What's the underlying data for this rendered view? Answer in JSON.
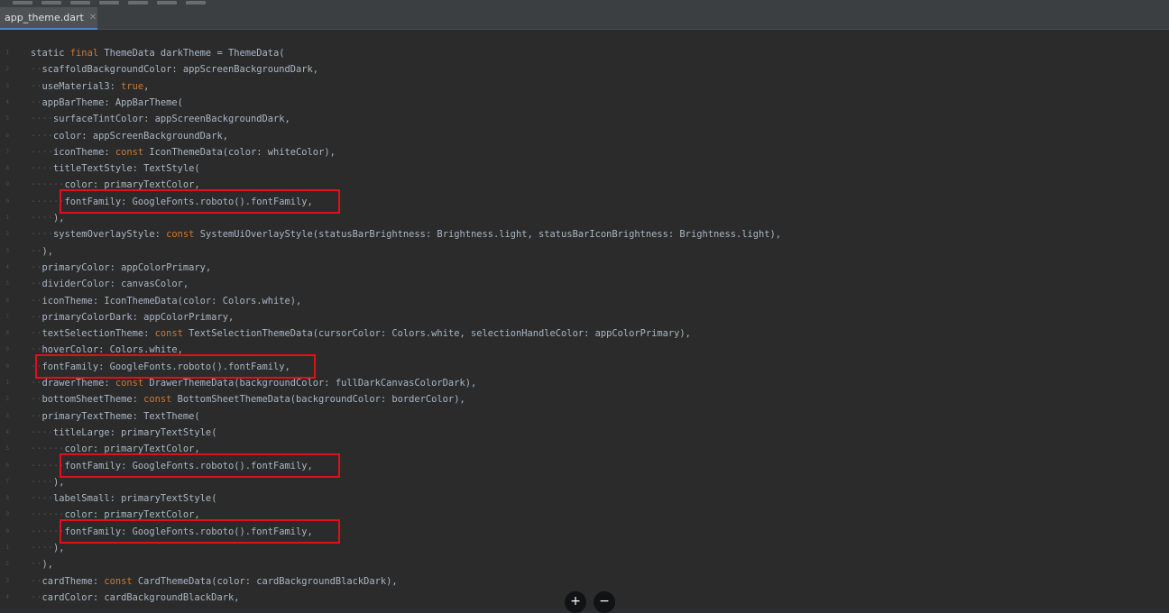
{
  "tab": {
    "title": "app_theme.dart",
    "close_icon": "close-icon"
  },
  "code_lines": [
    {
      "indent": 0,
      "segments": [
        {
          "t": "static ",
          "k": "p"
        },
        {
          "t": "final",
          "k": "kw"
        },
        {
          "t": " ThemeData darkTheme = ThemeData(",
          "k": "p"
        }
      ]
    },
    {
      "indent": 1,
      "segments": [
        {
          "t": "scaffoldBackgroundColor: appScreenBackgroundDark,",
          "k": "p"
        }
      ]
    },
    {
      "indent": 1,
      "segments": [
        {
          "t": "useMaterial3: ",
          "k": "p"
        },
        {
          "t": "true",
          "k": "kw"
        },
        {
          "t": ",",
          "k": "p"
        }
      ]
    },
    {
      "indent": 1,
      "segments": [
        {
          "t": "appBarTheme: AppBarTheme(",
          "k": "p"
        }
      ]
    },
    {
      "indent": 2,
      "segments": [
        {
          "t": "surfaceTintColor: appScreenBackgroundDark,",
          "k": "p"
        }
      ]
    },
    {
      "indent": 2,
      "segments": [
        {
          "t": "color: appScreenBackgroundDark,",
          "k": "p"
        }
      ]
    },
    {
      "indent": 2,
      "segments": [
        {
          "t": "iconTheme: ",
          "k": "p"
        },
        {
          "t": "const",
          "k": "kw"
        },
        {
          "t": " IconThemeData(color: whiteColor),",
          "k": "p"
        }
      ]
    },
    {
      "indent": 2,
      "segments": [
        {
          "t": "titleTextStyle: TextStyle(",
          "k": "p"
        }
      ]
    },
    {
      "indent": 3,
      "segments": [
        {
          "t": "color: primaryTextColor,",
          "k": "p"
        }
      ]
    },
    {
      "indent": 3,
      "segments": [
        {
          "t": "fontFamily: GoogleFonts.roboto().fontFamily,",
          "k": "p"
        }
      ]
    },
    {
      "indent": 2,
      "segments": [
        {
          "t": "),",
          "k": "p"
        }
      ]
    },
    {
      "indent": 2,
      "segments": [
        {
          "t": "systemOverlayStyle: ",
          "k": "p"
        },
        {
          "t": "const",
          "k": "kw"
        },
        {
          "t": " SystemUiOverlayStyle(statusBarBrightness: Brightness.light, statusBarIconBrightness: Brightness.light),",
          "k": "p"
        }
      ]
    },
    {
      "indent": 1,
      "segments": [
        {
          "t": "),",
          "k": "p"
        }
      ]
    },
    {
      "indent": 1,
      "segments": [
        {
          "t": "primaryColor: appColorPrimary,",
          "k": "p"
        }
      ]
    },
    {
      "indent": 1,
      "segments": [
        {
          "t": "dividerColor: canvasColor,",
          "k": "p"
        }
      ]
    },
    {
      "indent": 1,
      "segments": [
        {
          "t": "iconTheme: IconThemeData(color: Colors.white),",
          "k": "p"
        }
      ]
    },
    {
      "indent": 1,
      "segments": [
        {
          "t": "primaryColorDark: appColorPrimary,",
          "k": "p"
        }
      ]
    },
    {
      "indent": 1,
      "segments": [
        {
          "t": "textSelectionTheme: ",
          "k": "p"
        },
        {
          "t": "const",
          "k": "kw"
        },
        {
          "t": " TextSelectionThemeData(cursorColor: Colors.white, selectionHandleColor: appColorPrimary),",
          "k": "p"
        }
      ]
    },
    {
      "indent": 1,
      "segments": [
        {
          "t": "hoverColor: Colors.white,",
          "k": "p"
        }
      ]
    },
    {
      "indent": 1,
      "segments": [
        {
          "t": "fontFamily: GoogleFonts.roboto().fontFamily,",
          "k": "p"
        }
      ]
    },
    {
      "indent": 1,
      "segments": [
        {
          "t": "drawerTheme: ",
          "k": "p"
        },
        {
          "t": "const",
          "k": "kw"
        },
        {
          "t": " DrawerThemeData(backgroundColor: fullDarkCanvasColorDark),",
          "k": "p"
        }
      ]
    },
    {
      "indent": 1,
      "segments": [
        {
          "t": "bottomSheetTheme: ",
          "k": "p"
        },
        {
          "t": "const",
          "k": "kw"
        },
        {
          "t": " BottomSheetThemeData(backgroundColor: borderColor),",
          "k": "p"
        }
      ]
    },
    {
      "indent": 1,
      "segments": [
        {
          "t": "primaryTextTheme: TextTheme(",
          "k": "p"
        }
      ]
    },
    {
      "indent": 2,
      "segments": [
        {
          "t": "titleLarge: primaryTextStyle(",
          "k": "p"
        }
      ]
    },
    {
      "indent": 3,
      "segments": [
        {
          "t": "color: primaryTextColor,",
          "k": "p"
        }
      ]
    },
    {
      "indent": 3,
      "segments": [
        {
          "t": "fontFamily: GoogleFonts.roboto().fontFamily,",
          "k": "p"
        }
      ]
    },
    {
      "indent": 2,
      "segments": [
        {
          "t": "),",
          "k": "p"
        }
      ]
    },
    {
      "indent": 2,
      "segments": [
        {
          "t": "labelSmall: primaryTextStyle(",
          "k": "p"
        }
      ]
    },
    {
      "indent": 3,
      "segments": [
        {
          "t": "color: primaryTextColor,",
          "k": "p"
        }
      ]
    },
    {
      "indent": 3,
      "segments": [
        {
          "t": "fontFamily: GoogleFonts.roboto().fontFamily,",
          "k": "p"
        }
      ]
    },
    {
      "indent": 2,
      "segments": [
        {
          "t": "),",
          "k": "p"
        }
      ]
    },
    {
      "indent": 1,
      "segments": [
        {
          "t": "),",
          "k": "p"
        }
      ]
    },
    {
      "indent": 1,
      "segments": [
        {
          "t": "cardTheme: ",
          "k": "p"
        },
        {
          "t": "const",
          "k": "kw"
        },
        {
          "t": " CardThemeData(color: cardBackgroundBlackDark),",
          "k": "p"
        }
      ]
    },
    {
      "indent": 1,
      "segments": [
        {
          "t": "cardColor: cardBackgroundBlackDark,",
          "k": "p"
        }
      ]
    }
  ],
  "highlighted_lines": [
    9,
    19,
    25,
    29
  ],
  "colors": {
    "editor_bg": "#2b2b2b",
    "text": "#a9b7c6",
    "keyword": "#cc7832",
    "indent_dots": "#4a4d52",
    "highlight_border": "#e0101a"
  },
  "zoom_controls": {
    "zoom_in": "+",
    "zoom_out": "−"
  }
}
